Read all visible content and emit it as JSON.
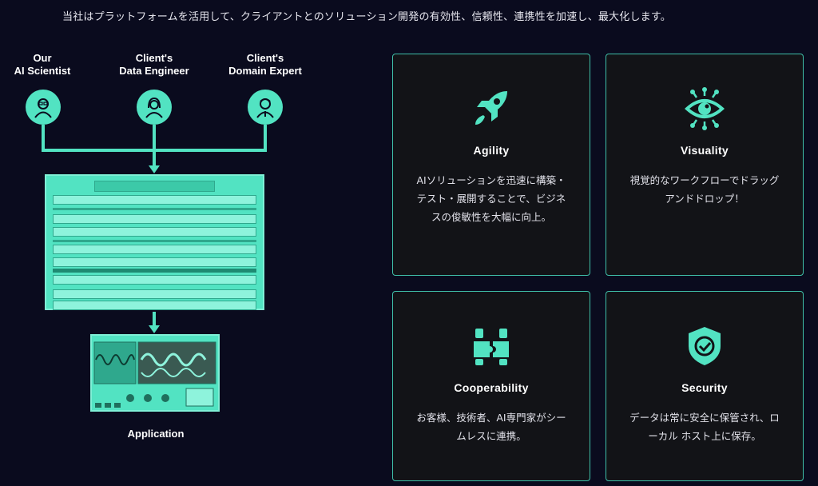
{
  "intro": "当社はプラットフォームを活用して、クライアントとのソリューション開発の有効性、信頼性、連携性を加速し、最大化します。",
  "diagram": {
    "roles": [
      {
        "line1": "Our",
        "line2": "AI Scientist",
        "icon": "scientist-avatar-icon"
      },
      {
        "line1": "Client's",
        "line2": "Data Engineer",
        "icon": "engineer-avatar-icon"
      },
      {
        "line1": "Client's",
        "line2": "Domain Expert",
        "icon": "expert-avatar-icon"
      }
    ],
    "application_label": "Application"
  },
  "cards": [
    {
      "title": "Agility",
      "desc": "AIソリューションを迅速に構築・テスト・展開することで、ビジネスの俊敏性を大幅に向上。",
      "icon": "rocket-icon"
    },
    {
      "title": "Visuality",
      "desc": "視覚的なワークフローでドラッグアンドドロップ！",
      "icon": "eye-icon"
    },
    {
      "title": "Cooperability",
      "desc": "お客様、技術者、AI専門家がシームレスに連携。",
      "icon": "puzzle-hands-icon"
    },
    {
      "title": "Security",
      "desc": "データは常に安全に保管され、ローカル ホスト上に保存。",
      "icon": "shield-check-icon"
    }
  ],
  "colors": {
    "accent": "#52e3c2",
    "background": "#0a0b1e",
    "card_bg": "#121317",
    "card_border": "#3fbfa8"
  }
}
